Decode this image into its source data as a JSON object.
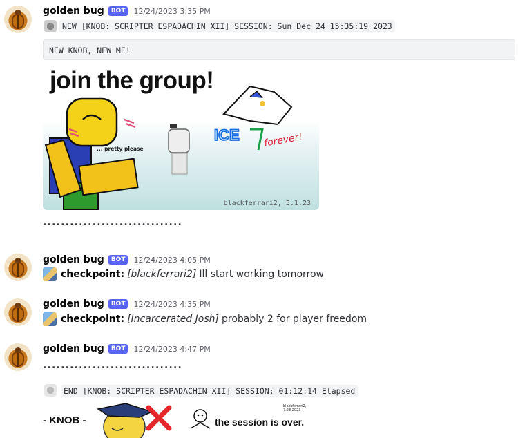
{
  "messages": [
    {
      "username": "golden bug",
      "bot_tag": "BOT",
      "timestamp": "12/24/2023 3:35 PM",
      "session_start": "NEW [KNOB: SCRIPTER ESPADACHIN XII] SESSION: Sun Dec 24 15:35:19 2023",
      "codeblock": "NEW KNOB, NEW ME!",
      "image": {
        "title": "join the group!",
        "caption": "... pretty please",
        "handwriting": "forever!",
        "credit": "blackferrari2, 5.1.23"
      },
      "dots": "..............................."
    },
    {
      "username": "golden bug",
      "bot_tag": "BOT",
      "timestamp": "12/24/2023 4:05 PM",
      "label": "checkpoint:",
      "author": "[blackferrari2]",
      "text": "Ill start working tomorrow"
    },
    {
      "username": "golden bug",
      "bot_tag": "BOT",
      "timestamp": "12/24/2023 4:35 PM",
      "label": "checkpoint:",
      "author": "[Incarcerated Josh]",
      "text": "probably 2 for player freedom"
    },
    {
      "username": "golden bug",
      "bot_tag": "BOT",
      "timestamp": "12/24/2023 4:47 PM",
      "dots": "...............................",
      "session_end": "END [KNOB: SCRIPTER ESPADACHIN XII] SESSION: 01:12:14 Elapsed",
      "image": {
        "left_text": "- KNOB -",
        "right_text": "the session is over.",
        "credit": "blackferrari2, 7.28.2023"
      }
    }
  ],
  "colors": {
    "bot_tag": "#5865f2",
    "code_bg": "#f2f3f5",
    "timestamp": "#5c5e66"
  }
}
